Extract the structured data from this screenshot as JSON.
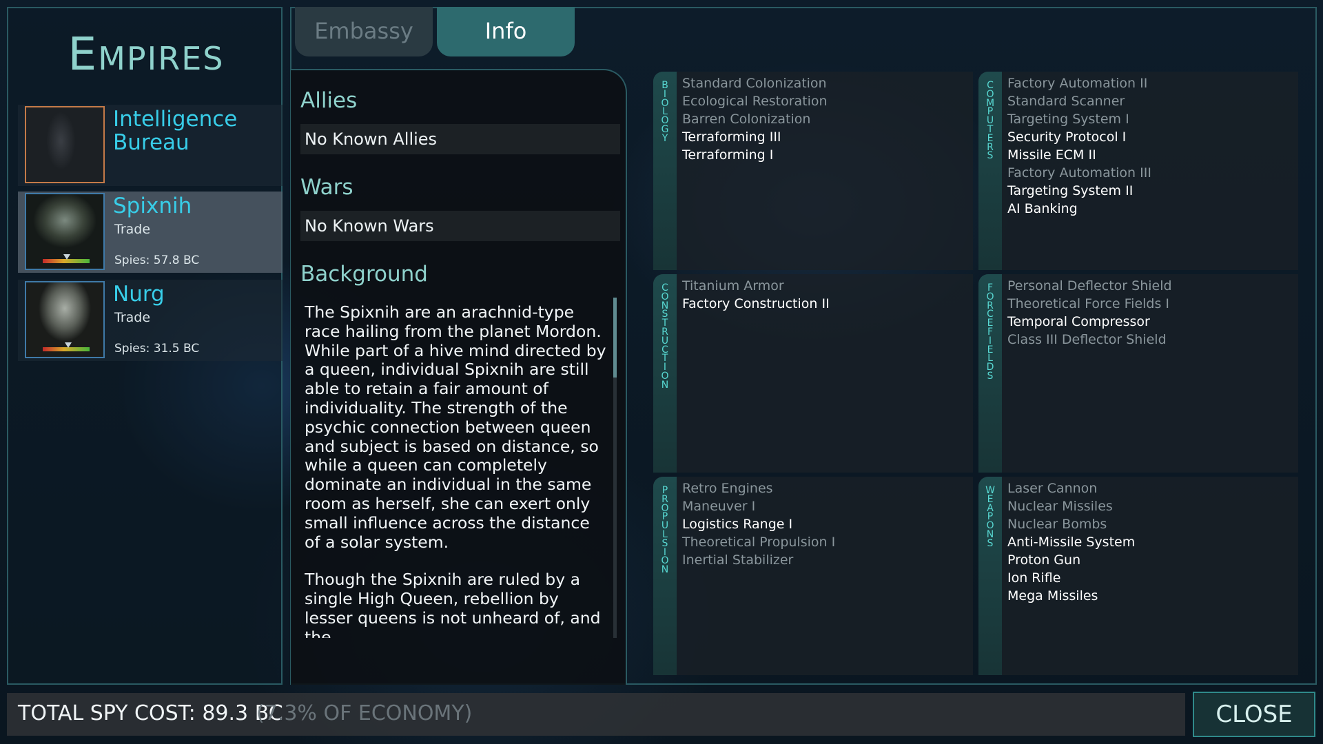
{
  "title": "Empires",
  "empires": [
    {
      "name": "Intelligence Bureau",
      "relation": "",
      "spies": ""
    },
    {
      "name": "Spixnih",
      "relation": "Trade",
      "spies": "Spies: 57.8 BC"
    },
    {
      "name": "Nurg",
      "relation": "Trade",
      "spies": "Spies: 31.5 BC"
    }
  ],
  "tabs": {
    "embassy": "Embassy",
    "info": "Info"
  },
  "info": {
    "allies_label": "Allies",
    "allies_value": "No Known Allies",
    "wars_label": "Wars",
    "wars_value": "No Known Wars",
    "background_label": "Background",
    "background_p1": "The Spixnih are an arachnid-type race hailing from the planet Mordon. While part of a hive mind directed by a queen, individual Spixnih are still able to retain a fair amount of individuality. The strength of the psychic connection between queen and subject is based on distance, so while a queen can completely dominate an individual in the same room as herself, she can exert only small influence across the distance of a solar system.",
    "background_p2": "Though the Spixnih are ruled by a single High Queen, rebellion by lesser queens is not unheard of, and the"
  },
  "tech": {
    "biology": {
      "label": "BIOLOGY",
      "items": [
        {
          "name": "Standard Colonization",
          "known": false
        },
        {
          "name": "Ecological Restoration",
          "known": false
        },
        {
          "name": "Barren Colonization",
          "known": false
        },
        {
          "name": "Terraforming III",
          "known": true
        },
        {
          "name": "Terraforming I",
          "known": true
        }
      ]
    },
    "computers": {
      "label": "COMPUTERS",
      "items": [
        {
          "name": "Factory Automation II",
          "known": false
        },
        {
          "name": "Standard Scanner",
          "known": false
        },
        {
          "name": "Targeting System I",
          "known": false
        },
        {
          "name": "Security Protocol I",
          "known": true
        },
        {
          "name": "Missile ECM II",
          "known": true
        },
        {
          "name": "Factory Automation III",
          "known": false
        },
        {
          "name": "Targeting System II",
          "known": true
        },
        {
          "name": "AI Banking",
          "known": true
        }
      ]
    },
    "construction": {
      "label": "CONSTRUCTION",
      "items": [
        {
          "name": "Titanium Armor",
          "known": false
        },
        {
          "name": "Factory Construction II",
          "known": true
        }
      ]
    },
    "forcefields": {
      "label": "FORCEFIELDS",
      "items": [
        {
          "name": "Personal Deflector Shield",
          "known": false
        },
        {
          "name": "Theoretical Force Fields I",
          "known": false
        },
        {
          "name": "Temporal Compressor",
          "known": true
        },
        {
          "name": "Class III Deflector Shield",
          "known": false
        }
      ]
    },
    "propulsion": {
      "label": "PROPULSION",
      "items": [
        {
          "name": "Retro Engines",
          "known": false
        },
        {
          "name": "Maneuver I",
          "known": false
        },
        {
          "name": "Logistics Range I",
          "known": true
        },
        {
          "name": "Theoretical Propulsion I",
          "known": false
        },
        {
          "name": "Inertial Stabilizer",
          "known": false
        }
      ]
    },
    "weapons": {
      "label": "WEAPONS",
      "items": [
        {
          "name": "Laser Cannon",
          "known": false
        },
        {
          "name": "Nuclear Missiles",
          "known": false
        },
        {
          "name": "Nuclear Bombs",
          "known": false
        },
        {
          "name": "Anti-Missile System",
          "known": true
        },
        {
          "name": "Proton Gun",
          "known": true
        },
        {
          "name": "Ion Rifle",
          "known": true
        },
        {
          "name": "Mega Missiles",
          "known": true
        }
      ]
    }
  },
  "footer": {
    "total_spy_cost": "TOTAL SPY COST: 89.3 BC",
    "economy_pct": "(7.3% OF ECONOMY)",
    "close": "CLOSE"
  },
  "colors": {
    "accent": "#38cde8",
    "title": "#8fd2cc",
    "panel_border": "#2a5a62",
    "close_border": "#2f8a8a"
  }
}
